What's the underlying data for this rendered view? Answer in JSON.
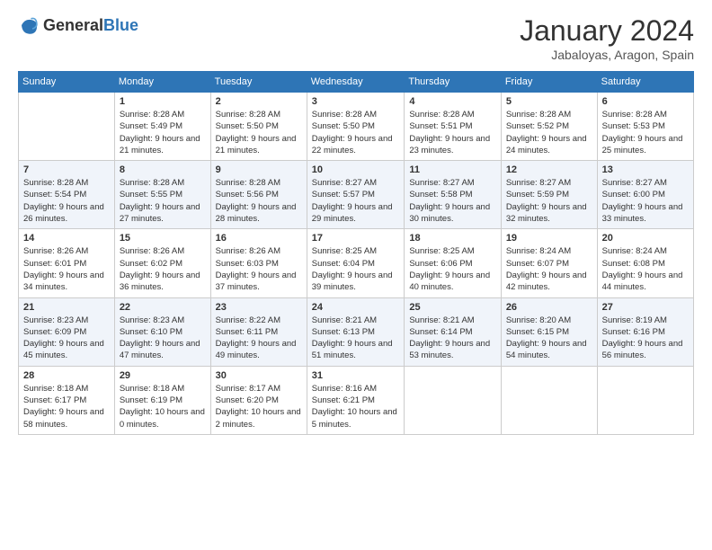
{
  "header": {
    "logo_general": "General",
    "logo_blue": "Blue",
    "month": "January 2024",
    "location": "Jabaloyas, Aragon, Spain"
  },
  "weekdays": [
    "Sunday",
    "Monday",
    "Tuesday",
    "Wednesday",
    "Thursday",
    "Friday",
    "Saturday"
  ],
  "weeks": [
    [
      {
        "day": "",
        "sunrise": "",
        "sunset": "",
        "daylight": ""
      },
      {
        "day": "1",
        "sunrise": "Sunrise: 8:28 AM",
        "sunset": "Sunset: 5:49 PM",
        "daylight": "Daylight: 9 hours and 21 minutes."
      },
      {
        "day": "2",
        "sunrise": "Sunrise: 8:28 AM",
        "sunset": "Sunset: 5:50 PM",
        "daylight": "Daylight: 9 hours and 21 minutes."
      },
      {
        "day": "3",
        "sunrise": "Sunrise: 8:28 AM",
        "sunset": "Sunset: 5:50 PM",
        "daylight": "Daylight: 9 hours and 22 minutes."
      },
      {
        "day": "4",
        "sunrise": "Sunrise: 8:28 AM",
        "sunset": "Sunset: 5:51 PM",
        "daylight": "Daylight: 9 hours and 23 minutes."
      },
      {
        "day": "5",
        "sunrise": "Sunrise: 8:28 AM",
        "sunset": "Sunset: 5:52 PM",
        "daylight": "Daylight: 9 hours and 24 minutes."
      },
      {
        "day": "6",
        "sunrise": "Sunrise: 8:28 AM",
        "sunset": "Sunset: 5:53 PM",
        "daylight": "Daylight: 9 hours and 25 minutes."
      }
    ],
    [
      {
        "day": "7",
        "sunrise": "Sunrise: 8:28 AM",
        "sunset": "Sunset: 5:54 PM",
        "daylight": "Daylight: 9 hours and 26 minutes."
      },
      {
        "day": "8",
        "sunrise": "Sunrise: 8:28 AM",
        "sunset": "Sunset: 5:55 PM",
        "daylight": "Daylight: 9 hours and 27 minutes."
      },
      {
        "day": "9",
        "sunrise": "Sunrise: 8:28 AM",
        "sunset": "Sunset: 5:56 PM",
        "daylight": "Daylight: 9 hours and 28 minutes."
      },
      {
        "day": "10",
        "sunrise": "Sunrise: 8:27 AM",
        "sunset": "Sunset: 5:57 PM",
        "daylight": "Daylight: 9 hours and 29 minutes."
      },
      {
        "day": "11",
        "sunrise": "Sunrise: 8:27 AM",
        "sunset": "Sunset: 5:58 PM",
        "daylight": "Daylight: 9 hours and 30 minutes."
      },
      {
        "day": "12",
        "sunrise": "Sunrise: 8:27 AM",
        "sunset": "Sunset: 5:59 PM",
        "daylight": "Daylight: 9 hours and 32 minutes."
      },
      {
        "day": "13",
        "sunrise": "Sunrise: 8:27 AM",
        "sunset": "Sunset: 6:00 PM",
        "daylight": "Daylight: 9 hours and 33 minutes."
      }
    ],
    [
      {
        "day": "14",
        "sunrise": "Sunrise: 8:26 AM",
        "sunset": "Sunset: 6:01 PM",
        "daylight": "Daylight: 9 hours and 34 minutes."
      },
      {
        "day": "15",
        "sunrise": "Sunrise: 8:26 AM",
        "sunset": "Sunset: 6:02 PM",
        "daylight": "Daylight: 9 hours and 36 minutes."
      },
      {
        "day": "16",
        "sunrise": "Sunrise: 8:26 AM",
        "sunset": "Sunset: 6:03 PM",
        "daylight": "Daylight: 9 hours and 37 minutes."
      },
      {
        "day": "17",
        "sunrise": "Sunrise: 8:25 AM",
        "sunset": "Sunset: 6:04 PM",
        "daylight": "Daylight: 9 hours and 39 minutes."
      },
      {
        "day": "18",
        "sunrise": "Sunrise: 8:25 AM",
        "sunset": "Sunset: 6:06 PM",
        "daylight": "Daylight: 9 hours and 40 minutes."
      },
      {
        "day": "19",
        "sunrise": "Sunrise: 8:24 AM",
        "sunset": "Sunset: 6:07 PM",
        "daylight": "Daylight: 9 hours and 42 minutes."
      },
      {
        "day": "20",
        "sunrise": "Sunrise: 8:24 AM",
        "sunset": "Sunset: 6:08 PM",
        "daylight": "Daylight: 9 hours and 44 minutes."
      }
    ],
    [
      {
        "day": "21",
        "sunrise": "Sunrise: 8:23 AM",
        "sunset": "Sunset: 6:09 PM",
        "daylight": "Daylight: 9 hours and 45 minutes."
      },
      {
        "day": "22",
        "sunrise": "Sunrise: 8:23 AM",
        "sunset": "Sunset: 6:10 PM",
        "daylight": "Daylight: 9 hours and 47 minutes."
      },
      {
        "day": "23",
        "sunrise": "Sunrise: 8:22 AM",
        "sunset": "Sunset: 6:11 PM",
        "daylight": "Daylight: 9 hours and 49 minutes."
      },
      {
        "day": "24",
        "sunrise": "Sunrise: 8:21 AM",
        "sunset": "Sunset: 6:13 PM",
        "daylight": "Daylight: 9 hours and 51 minutes."
      },
      {
        "day": "25",
        "sunrise": "Sunrise: 8:21 AM",
        "sunset": "Sunset: 6:14 PM",
        "daylight": "Daylight: 9 hours and 53 minutes."
      },
      {
        "day": "26",
        "sunrise": "Sunrise: 8:20 AM",
        "sunset": "Sunset: 6:15 PM",
        "daylight": "Daylight: 9 hours and 54 minutes."
      },
      {
        "day": "27",
        "sunrise": "Sunrise: 8:19 AM",
        "sunset": "Sunset: 6:16 PM",
        "daylight": "Daylight: 9 hours and 56 minutes."
      }
    ],
    [
      {
        "day": "28",
        "sunrise": "Sunrise: 8:18 AM",
        "sunset": "Sunset: 6:17 PM",
        "daylight": "Daylight: 9 hours and 58 minutes."
      },
      {
        "day": "29",
        "sunrise": "Sunrise: 8:18 AM",
        "sunset": "Sunset: 6:19 PM",
        "daylight": "Daylight: 10 hours and 0 minutes."
      },
      {
        "day": "30",
        "sunrise": "Sunrise: 8:17 AM",
        "sunset": "Sunset: 6:20 PM",
        "daylight": "Daylight: 10 hours and 2 minutes."
      },
      {
        "day": "31",
        "sunrise": "Sunrise: 8:16 AM",
        "sunset": "Sunset: 6:21 PM",
        "daylight": "Daylight: 10 hours and 5 minutes."
      },
      {
        "day": "",
        "sunrise": "",
        "sunset": "",
        "daylight": ""
      },
      {
        "day": "",
        "sunrise": "",
        "sunset": "",
        "daylight": ""
      },
      {
        "day": "",
        "sunrise": "",
        "sunset": "",
        "daylight": ""
      }
    ]
  ]
}
